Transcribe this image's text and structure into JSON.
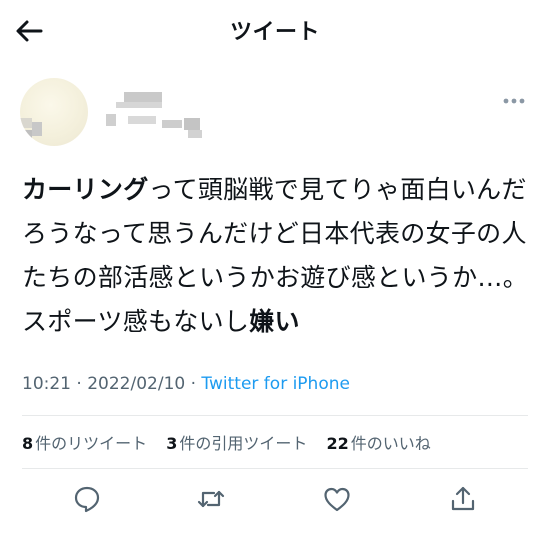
{
  "header": {
    "back_icon": "arrow-left-icon",
    "title": "ツイート"
  },
  "tweet": {
    "text_segments": [
      {
        "text": "カーリング",
        "bold": true
      },
      {
        "text": "って頭脳戦で見てりゃ面白いんだろうなって思うんだけど日本代表の女子の人たちの部活感というかお遊び感というか…。スポーツ感もないし",
        "bold": false
      },
      {
        "text": "嫌い",
        "bold": true
      }
    ],
    "time": "10:21",
    "date": "2022/02/10",
    "separator": "·",
    "source": "Twitter for iPhone"
  },
  "stats": [
    {
      "count": "8",
      "label": "件のリツイート"
    },
    {
      "count": "3",
      "label": "件の引用ツイート"
    },
    {
      "count": "22",
      "label": "件のいいね"
    }
  ],
  "actions": {
    "icons": [
      "reply-icon",
      "retweet-icon",
      "like-icon",
      "share-icon"
    ]
  },
  "colors": {
    "text": "#0f1419",
    "secondary": "#536471",
    "link": "#1d9bf0",
    "divider": "#e7e9ea"
  }
}
